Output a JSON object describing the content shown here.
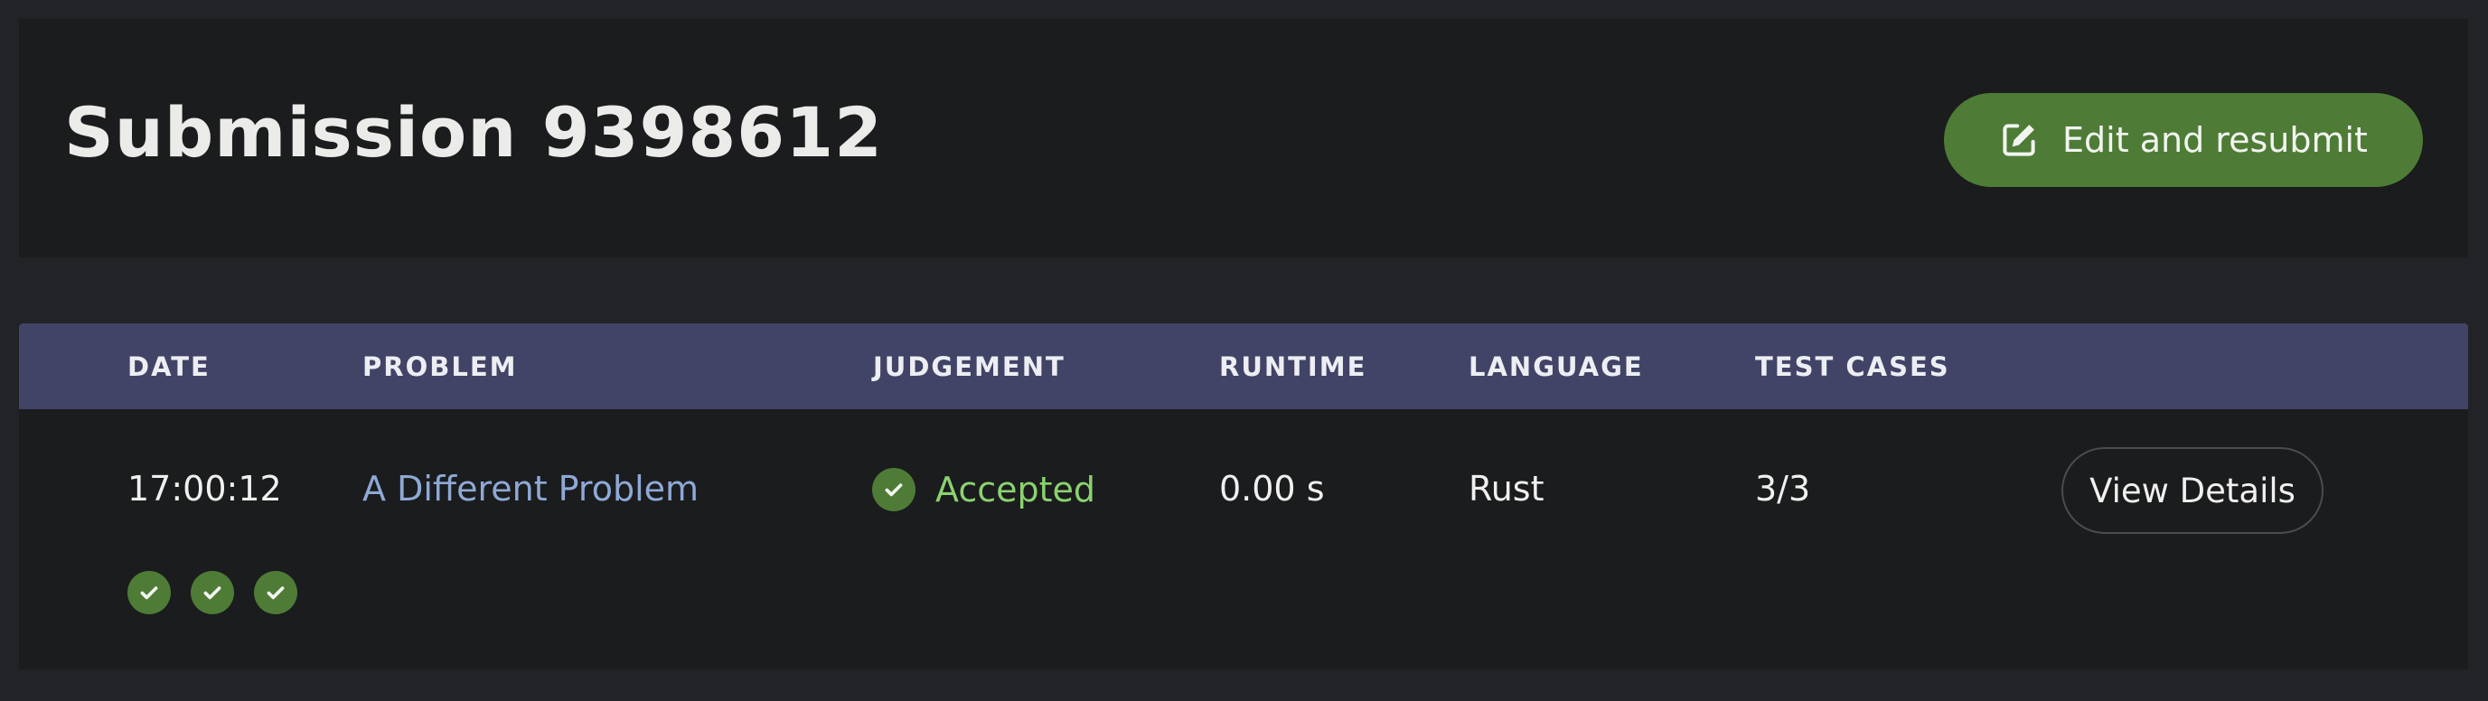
{
  "header": {
    "title": "Submission 9398612",
    "resubmit_label": "Edit and resubmit",
    "resubmit_icon": "edit-icon",
    "accent_color": "#4e7c37"
  },
  "table": {
    "header_color": "#414466",
    "columns": [
      "DATE",
      "PROBLEM",
      "JUDGEMENT",
      "RUNTIME",
      "LANGUAGE",
      "TEST CASES"
    ],
    "row": {
      "date": "17:00:12",
      "problem": "A Different Problem",
      "judgement": "Accepted",
      "judgement_icon": "check-circle-icon",
      "judgement_color": "#8bd26f",
      "runtime": "0.00 s",
      "language": "Rust",
      "test_cases": "3/3",
      "details_label": "View Details",
      "case_results": [
        "passed",
        "passed",
        "passed"
      ]
    }
  }
}
